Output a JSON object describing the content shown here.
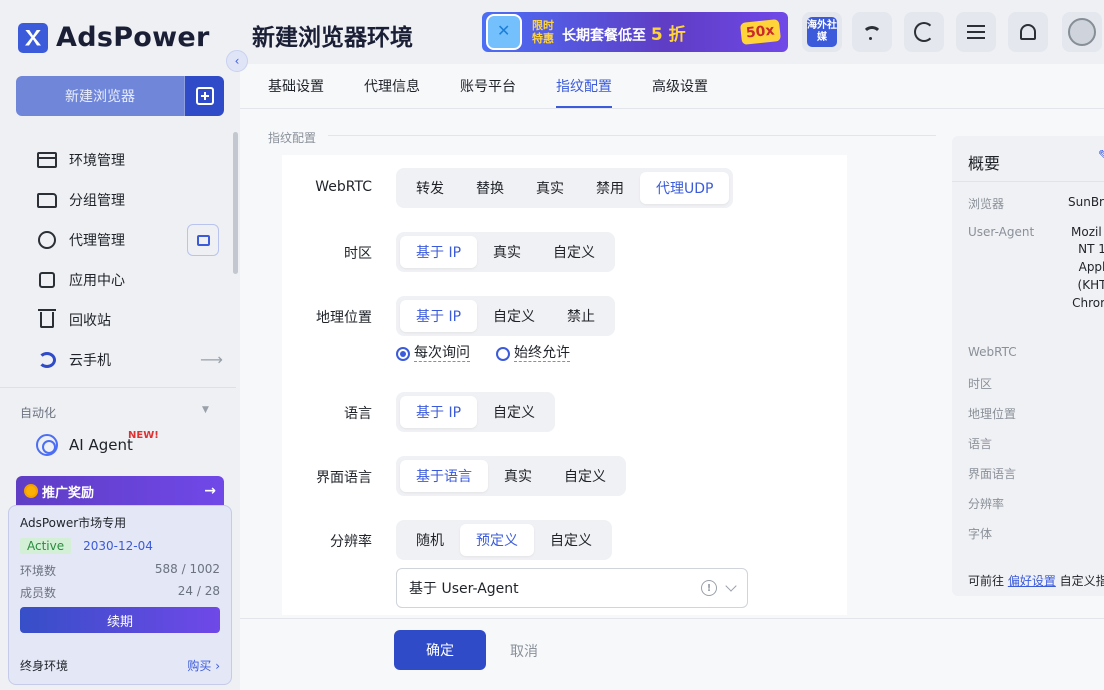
{
  "app": {
    "name": "AdsPower"
  },
  "sidebar": {
    "new_browser_label": "新建浏览器",
    "items": [
      {
        "label": "环境管理",
        "icon": "browser-window-icon"
      },
      {
        "label": "分组管理",
        "icon": "folder-icon"
      },
      {
        "label": "代理管理",
        "icon": "globe-icon"
      },
      {
        "label": "应用中心",
        "icon": "puzzle-icon"
      },
      {
        "label": "回收站",
        "icon": "trash-icon"
      },
      {
        "label": "云手机",
        "icon": "cloud-phone-icon"
      }
    ],
    "automation_label": "自动化",
    "ai_agent": {
      "label": "AI Agent",
      "badge": "NEW!"
    },
    "promo": {
      "label": "推广奖励"
    },
    "plan": {
      "title": "AdsPower市场专用",
      "status": "Active",
      "expiry": "2030-12-04",
      "env_label": "环境数",
      "env_value": "588 / 1002",
      "member_label": "成员数",
      "member_value": "24 / 28",
      "renew_label": "续期",
      "lifetime_label": "终身环境",
      "buy_label": "购买 ›"
    }
  },
  "header": {
    "title": "新建浏览器环境",
    "banner": {
      "small": "限时特惠",
      "text_prefix": "长期套餐低至 ",
      "text_highlight": "5 折",
      "badge": "50x"
    },
    "overseas_label": "海外社媒"
  },
  "tabs": [
    {
      "label": "基础设置",
      "active": false
    },
    {
      "label": "代理信息",
      "active": false
    },
    {
      "label": "账号平台",
      "active": false
    },
    {
      "label": "指纹配置",
      "active": true
    },
    {
      "label": "高级设置",
      "active": false
    }
  ],
  "section_title": "指纹配置",
  "form": {
    "webrtc": {
      "label": "WebRTC",
      "options": [
        "转发",
        "替换",
        "真实",
        "禁用",
        "代理UDP"
      ],
      "selected": "代理UDP"
    },
    "timezone": {
      "label": "时区",
      "options": [
        "基于 IP",
        "真实",
        "自定义"
      ],
      "selected": "基于 IP"
    },
    "geo": {
      "label": "地理位置",
      "options": [
        "基于 IP",
        "自定义",
        "禁止"
      ],
      "selected": "基于 IP",
      "radio_options": [
        "每次询问",
        "始终允许"
      ],
      "radio_selected": "每次询问"
    },
    "language": {
      "label": "语言",
      "options": [
        "基于 IP",
        "自定义"
      ],
      "selected": "基于 IP"
    },
    "ui_language": {
      "label": "界面语言",
      "options": [
        "基于语言",
        "真实",
        "自定义"
      ],
      "selected": "基于语言"
    },
    "resolution": {
      "label": "分辨率",
      "options": [
        "随机",
        "预定义",
        "自定义"
      ],
      "selected": "预定义",
      "select_value": "基于 User-Agent"
    }
  },
  "overview": {
    "title": "概要",
    "rows": [
      {
        "label": "浏览器",
        "value": "SunBro"
      },
      {
        "label": "User-Agent",
        "value": "Mozil"
      },
      {
        "label": "WebRTC",
        "value": ""
      },
      {
        "label": "时区",
        "value": ""
      },
      {
        "label": "地理位置",
        "value": ""
      },
      {
        "label": "语言",
        "value": ""
      },
      {
        "label": "界面语言",
        "value": ""
      },
      {
        "label": "分辨率",
        "value": ""
      },
      {
        "label": "字体",
        "value": ""
      }
    ],
    "ua_lines": [
      "NT 1",
      "Appl",
      "(KHT",
      "Chrom"
    ],
    "footer_prefix": "可前往 ",
    "footer_link": "偏好设置",
    "footer_suffix": " 自定义指"
  },
  "actions": {
    "confirm_label": "确定",
    "cancel_label": "取消"
  }
}
